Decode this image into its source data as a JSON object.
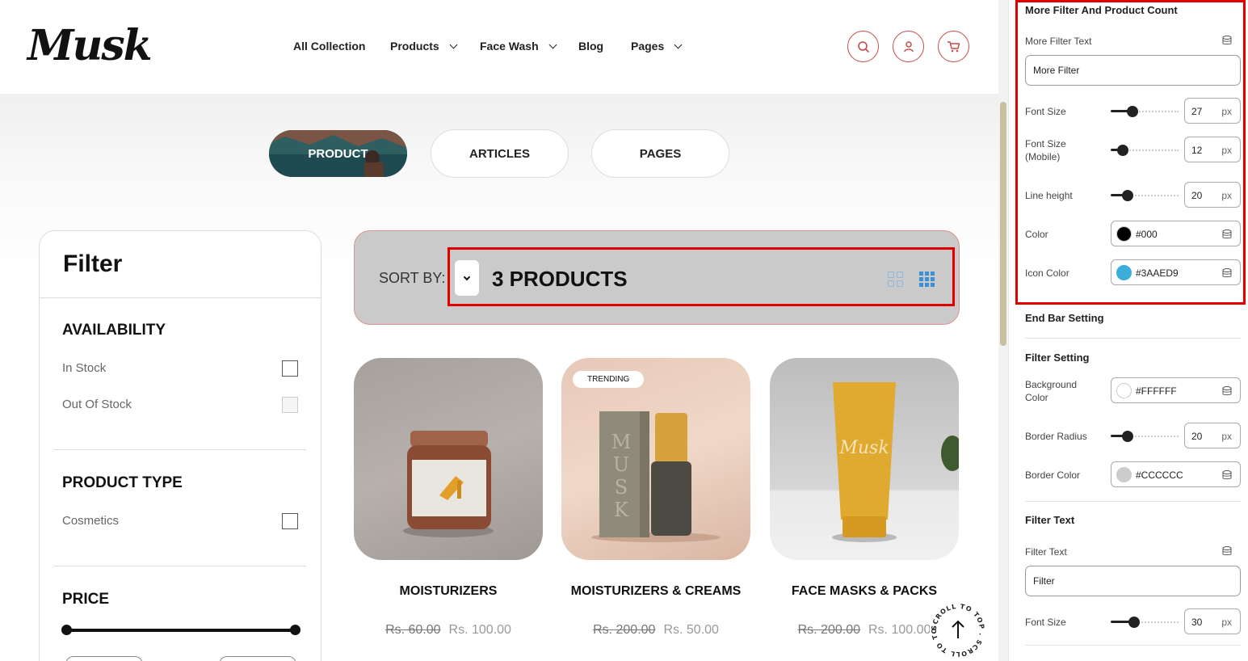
{
  "header": {
    "logo": "Musk",
    "nav": [
      {
        "label": "All Collection",
        "has_dropdown": false
      },
      {
        "label": "Products",
        "has_dropdown": true
      },
      {
        "label": "Face Wash",
        "has_dropdown": true
      },
      {
        "label": "Blog",
        "has_dropdown": false
      },
      {
        "label": "Pages",
        "has_dropdown": true
      }
    ],
    "icons": [
      "search-icon",
      "user-icon",
      "cart-icon"
    ],
    "accent": "#C94A4A"
  },
  "tabs": [
    {
      "label": "PRODUCT",
      "active": true
    },
    {
      "label": "ARTICLES",
      "active": false
    },
    {
      "label": "PAGES",
      "active": false
    }
  ],
  "filter": {
    "title": "Filter",
    "sections": [
      {
        "heading": "AVAILABILITY",
        "options": [
          {
            "label": "In Stock",
            "enabled": true
          },
          {
            "label": "Out Of Stock",
            "enabled": false
          }
        ]
      },
      {
        "heading": "PRODUCT TYPE",
        "options": [
          {
            "label": "Cosmetics",
            "enabled": true
          }
        ]
      },
      {
        "heading": "PRICE",
        "options": []
      }
    ]
  },
  "toolbar": {
    "sort_label": "SORT BY:",
    "product_count": "3 PRODUCTS",
    "background": "#CACACA",
    "icon_color": "#3AAED9"
  },
  "products": [
    {
      "title": "MOISTURIZERS",
      "old_price": "Rs. 60.00",
      "new_price": "Rs. 100.00",
      "badge": ""
    },
    {
      "title": "MOISTURIZERS & CREAMS",
      "old_price": "Rs. 200.00",
      "new_price": "Rs. 50.00",
      "badge": "TRENDING"
    },
    {
      "title": "FACE MASKS & PACKS",
      "old_price": "Rs. 200.00",
      "new_price": "Rs. 100.00",
      "badge": ""
    }
  ],
  "scroll_to_top": {
    "label": "SCROLL TO TOP . SCROLL TO TOP ."
  },
  "settings": {
    "more_filter_section": {
      "title": "More Filter And Product Count",
      "more_filter_text_label": "More Filter Text",
      "more_filter_text_value": "More Filter",
      "font_size_label": "Font Size",
      "font_size_value": "27",
      "font_size_mobile_label": "Font Size (Mobile)",
      "font_size_mobile_value": "12",
      "line_height_label": "Line height",
      "line_height_value": "20",
      "color_label": "Color",
      "color_value": "#000",
      "icon_color_label": "Icon Color",
      "icon_color_value": "#3AAED9",
      "unit": "px"
    },
    "end_bar": {
      "title": "End Bar Setting"
    },
    "filter_setting": {
      "title": "Filter Setting",
      "bg_label": "Background Color",
      "bg_value": "#FFFFFF",
      "radius_label": "Border Radius",
      "radius_value": "20",
      "border_color_label": "Border Color",
      "border_color_value": "#CCCCCC"
    },
    "filter_text": {
      "title": "Filter Text",
      "text_label": "Filter Text",
      "text_value": "Filter",
      "font_size_label": "Font Size",
      "font_size_value": "30"
    }
  }
}
